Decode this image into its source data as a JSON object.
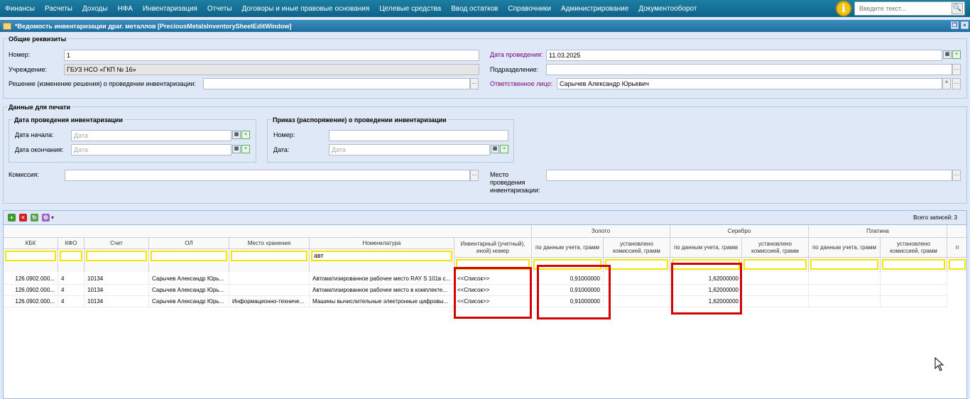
{
  "menu": [
    "Финансы",
    "Расчеты",
    "Доходы",
    "НФА",
    "Инвентаризация",
    "Отчеты",
    "Договоры и иные правовые основания",
    "Целевые средства",
    "Ввод остатков",
    "Справочники",
    "Администрирование",
    "Документооборот"
  ],
  "search": {
    "placeholder": "Введите текст..."
  },
  "window": {
    "title": "*Ведомость инвентаризации драг. металлов [PreciousMetalsInventorySheetEditWindow]"
  },
  "general": {
    "legend": "Общие реквизиты",
    "number_label": "Номер:",
    "number_value": "1",
    "institution_label": "Учреждение:",
    "institution_value": "ГБУЗ НСО «ГКП № 16»",
    "decision_label": "Решение (изменение решения) о проведении инвентаризации:",
    "decision_value": "",
    "date_label": "Дата проведения:",
    "date_value": "11.03.2025",
    "division_label": "Подразделение:",
    "division_value": "",
    "responsible_label": "Ответственное лицо:",
    "responsible_value": "Сарычев  Александр  Юрьевич"
  },
  "print": {
    "legend": "Данные для печати",
    "dates_legend": "Дата проведения инвентаризации",
    "start_label": "Дата начала:",
    "end_label": "Дата окончания:",
    "date_placeholder": "Дата",
    "order_legend": "Приказ (распоряжение) о проведении инвентаризации",
    "order_number_label": "Номер:",
    "order_date_label": "Дата:",
    "commission_label": "Комиссия:",
    "place_label_1": "Место",
    "place_label_2": "проведения",
    "place_label_3": "инвентаризации:"
  },
  "grid": {
    "total": "Всего записей:  3",
    "group_headers": [
      "Золото",
      "Серебро",
      "Платина"
    ],
    "columns": [
      "КБК",
      "КФО",
      "Счет",
      "ОЛ",
      "Место хранения",
      "Номенклатура",
      "Инвентарный (учетный), иной) номер",
      "по данным учета, грамм",
      "установлено комиссией, грамм",
      "по данным учета, грамм",
      "установлено комиссией, грамм",
      "по данным учета, грамм",
      "установлено комиссией, грамм",
      "п"
    ],
    "nomenclature_filter": "авт",
    "rows": [
      [
        "126.0902.000...",
        "4",
        "10134",
        "Сарычев Александр Юрь...",
        "",
        "Автоматизированное рабочее место RAY S 101в с...",
        "<<Список>>",
        "0,91000000",
        "",
        "1,62000000",
        "",
        "",
        ""
      ],
      [
        "126.0902.000...",
        "4",
        "10134",
        "Сарычев Александр Юрь...",
        "",
        "Автоматизированное рабочее место в комплекте...",
        "<<Список>>",
        "0,91000000",
        "",
        "1,62000000",
        "",
        "",
        ""
      ],
      [
        "126.0902.000...",
        "4",
        "10134",
        "Сарычев Александр Юрь...",
        "Информационно-техниче...",
        "Машины вычислительные электронные цифровы...",
        "<<Список>>",
        "0,91000000",
        "",
        "1,62000000",
        "",
        "",
        ""
      ]
    ]
  },
  "colors": {
    "highlight": "#d50000",
    "filter_border": "#f5e600",
    "topbar": "#0e6289"
  },
  "icons": {
    "info": "i",
    "search": "🔍",
    "add": "+",
    "delete": "×",
    "refresh": "↻",
    "settings": "⚙",
    "lookup": "...",
    "clear": "×"
  }
}
